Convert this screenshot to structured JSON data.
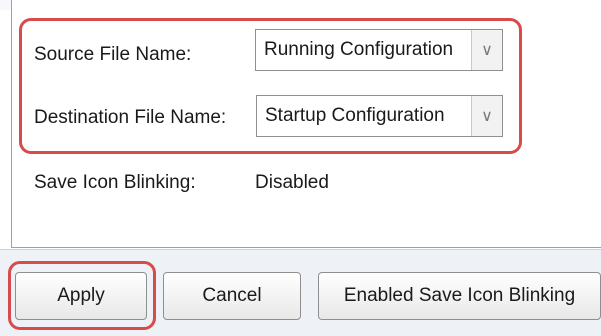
{
  "form": {
    "source_label": "Source File Name:",
    "source_value": "Running Configuration",
    "destination_label": "Destination File Name:",
    "destination_value": "Startup Configuration",
    "blink_label": "Save Icon Blinking:",
    "blink_value": "Disabled"
  },
  "buttons": {
    "apply": "Apply",
    "cancel": "Cancel",
    "enabled_save_icon_blinking": "Enabled Save Icon Blinking"
  },
  "icons": {
    "dropdown": "chevron-down-icon"
  },
  "colors": {
    "highlight": "#d64b4b",
    "panel_border": "#8aa4c6",
    "bottom_background": "#eef2f6"
  }
}
